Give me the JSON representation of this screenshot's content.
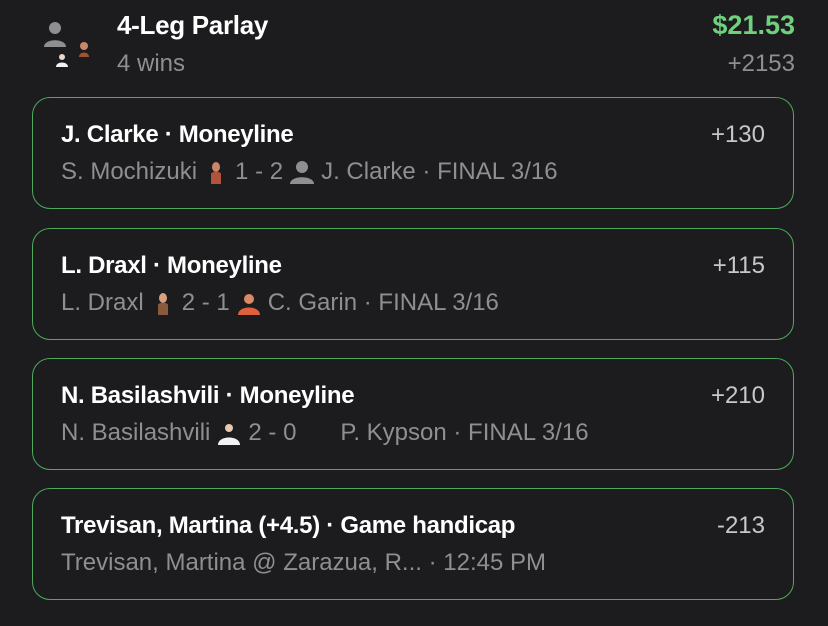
{
  "header": {
    "title": "4-Leg Parlay",
    "subtitle": "4 wins",
    "amount": "$21.53",
    "total_odds": "+2153"
  },
  "legs": [
    {
      "title": "J. Clarke · Moneyline",
      "odds": "+130",
      "player1": "S. Mochizuki",
      "score": "1 - 2",
      "player2": "J. Clarke · FINAL 3/16"
    },
    {
      "title": "L. Draxl · Moneyline",
      "odds": "+115",
      "player1": "L. Draxl",
      "score": "2 - 1",
      "player2": "C. Garin · FINAL 3/16"
    },
    {
      "title": "N. Basilashvili · Moneyline",
      "odds": "+210",
      "player1": "N. Basilashvili",
      "score": "2 - 0",
      "player2": "P. Kypson · FINAL 3/16"
    },
    {
      "title": "Trevisan, Martina (+4.5) · Game handicap",
      "odds": "-213",
      "detail": "Trevisan, Martina @ Zarazua, R... · 12:45 PM"
    }
  ],
  "colors": {
    "background": "#1c1c1e",
    "win_border": "#4caa5a",
    "win_amount": "#6fd17d",
    "muted_text": "#8e8e93"
  },
  "icons": [
    "player-avatar-icon",
    "silhouette-avatar-icon"
  ]
}
